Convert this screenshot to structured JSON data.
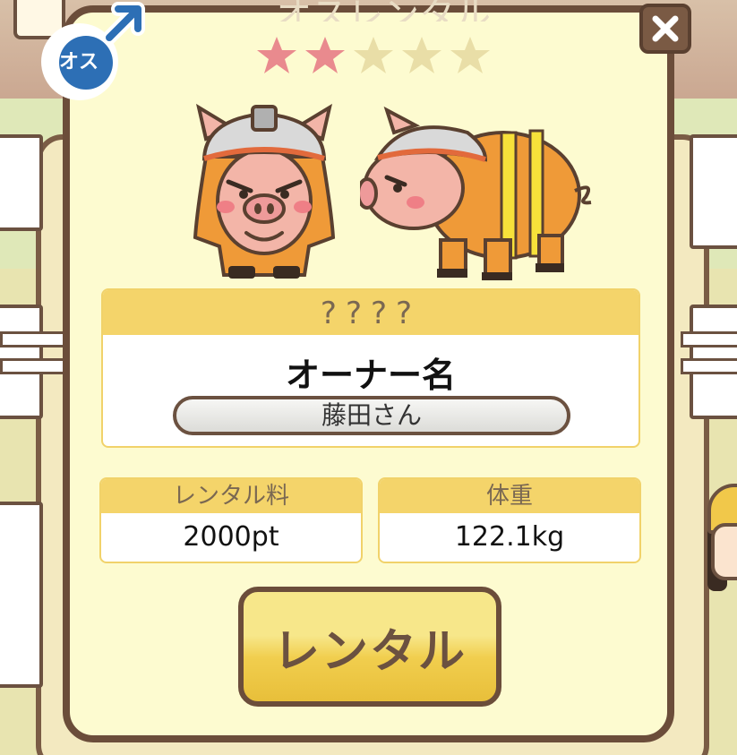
{
  "header": {
    "title_partial": "オスレンタル"
  },
  "gender": {
    "label": "オス",
    "icon": "male-symbol-icon",
    "color": "#2d6fb5"
  },
  "rating": {
    "filled": 2,
    "total": 5,
    "filled_color": "#e98a8e",
    "empty_color": "#e9dea7"
  },
  "close": {
    "icon": "close-icon"
  },
  "pig": {
    "name": "????",
    "front_image": "firefighter-pig-front",
    "side_image": "firefighter-pig-side"
  },
  "owner": {
    "label": "オーナー名",
    "value": "藤田さん"
  },
  "stats": {
    "fee_label": "レンタル料",
    "fee_value": "2000pt",
    "weight_label": "体重",
    "weight_value": "122.1kg"
  },
  "actions": {
    "rent_label": "レンタル"
  },
  "colors": {
    "panel_bg": "#fdfbd0",
    "border": "#6b4d3a",
    "accent": "#f4d46a"
  }
}
